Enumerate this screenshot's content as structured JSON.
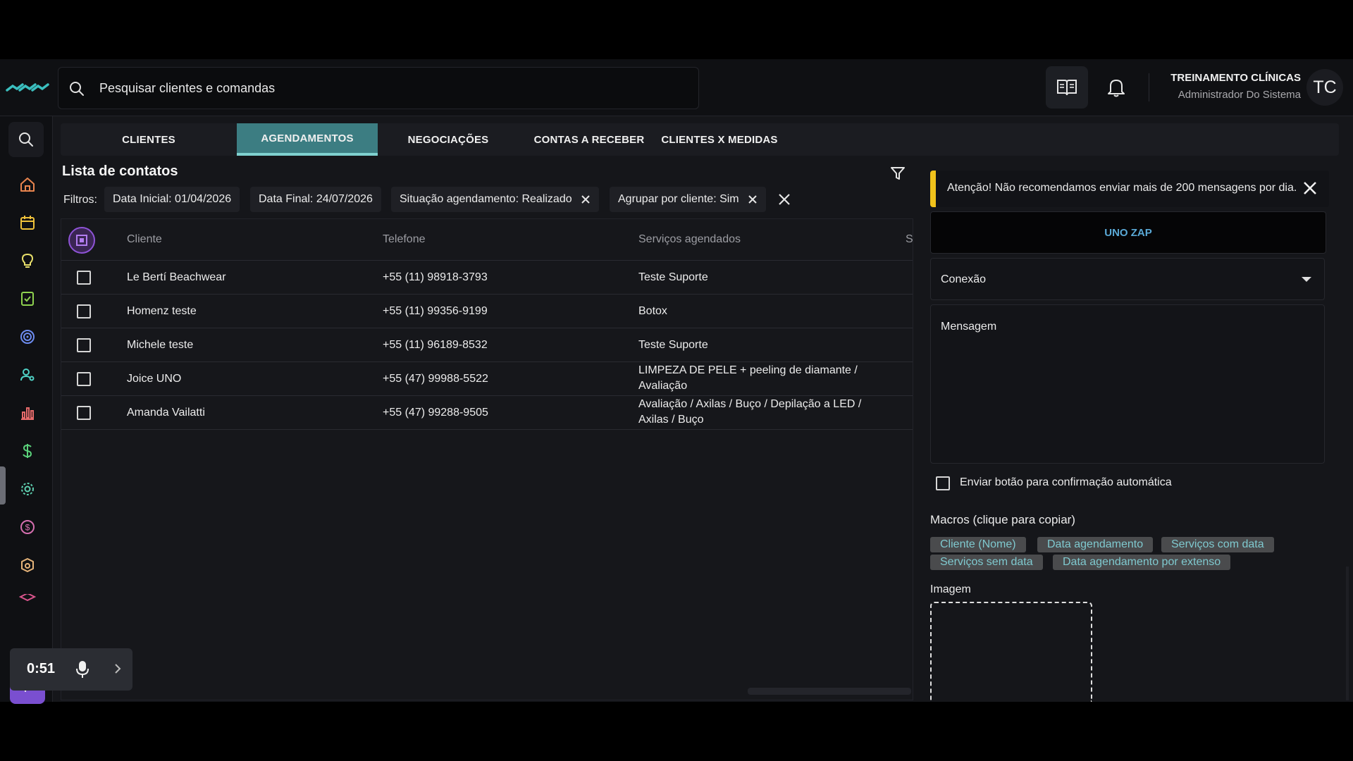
{
  "search": {
    "placeholder": "Pesquisar clientes e comandas"
  },
  "user": {
    "name": "TREINAMENTO CLÍNICAS",
    "role": "Administrador Do Sistema",
    "initials": "TC"
  },
  "tabs": [
    {
      "label": "CLIENTES"
    },
    {
      "label": "AGENDAMENTOS",
      "active": true
    },
    {
      "label": "NEGOCIAÇÕES"
    },
    {
      "label": "CONTAS A RECEBER"
    },
    {
      "label": "CLIENTES X MEDIDAS"
    }
  ],
  "list": {
    "title": "Lista de contatos",
    "filters_label": "Filtros:",
    "filters": [
      {
        "label": "Data Inicial: 01/04/2026",
        "removable": false
      },
      {
        "label": "Data Final: 24/07/2026",
        "removable": false
      },
      {
        "label": "Situação agendamento: Realizado",
        "removable": true
      },
      {
        "label": "Agrupar por cliente: Sim",
        "removable": true
      }
    ],
    "columns": [
      "Cliente",
      "Telefone",
      "Serviços agendados",
      "S"
    ],
    "rows": [
      {
        "cliente": "Le Bertí Beachwear",
        "telefone": "+55 (11) 98918-3793",
        "servicos": "Teste Suporte"
      },
      {
        "cliente": "Homenz teste",
        "telefone": "+55 (11) 99356-9199",
        "servicos": "Botox"
      },
      {
        "cliente": "Michele teste",
        "telefone": "+55 (11) 96189-8532",
        "servicos": "Teste Suporte"
      },
      {
        "cliente": "Joice UNO",
        "telefone": "+55 (47) 99988-5522",
        "servicos": "LIMPEZA DE PELE + peeling de diamante / Avaliação"
      },
      {
        "cliente": "Amanda Vailatti",
        "telefone": "+55 (47) 99288-9505",
        "servicos": "Avaliação / Axilas / Buço / Depilação a LED / Axilas / Buço"
      }
    ]
  },
  "panel": {
    "alert": "Atenção! Não recomendamos enviar mais de 200 mensagens por dia.",
    "zap_button": "UNO ZAP",
    "connection_label": "Conexão",
    "message_label": "Mensagem",
    "confirm_label": "Enviar botão para confirmação automática",
    "macros_title": "Macros (clique para copiar)",
    "macros": [
      "Cliente (Nome)",
      "Data agendamento",
      "Serviços com data",
      "Serviços sem data",
      "Data agendamento por extenso"
    ],
    "image_label": "Imagem"
  },
  "recorder": {
    "time": "0:51"
  },
  "colors": {
    "accent_tab": "#3c7d82",
    "alert_bar": "#f1c21b",
    "ai_button": "#7a4fd0",
    "macro_text": "#7fc9cf",
    "zap_text": "#5aa9d6"
  },
  "sidebar_icons": [
    "search-icon",
    "home-icon",
    "calendar-icon",
    "lightbulb-icon",
    "checklist-icon",
    "target-icon",
    "users-icon",
    "bar-chart-icon",
    "dollar-icon",
    "settings-icon",
    "coin-icon",
    "box-icon",
    "graduation-icon",
    "sparkles-icon"
  ]
}
